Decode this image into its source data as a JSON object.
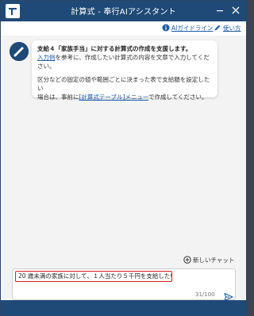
{
  "window": {
    "title": "計算式 - 奉行AIアシスタント",
    "colors": {
      "titlebar": "#1f4a78",
      "link": "#1a5aa8",
      "highlight_border": "#d62020"
    }
  },
  "toolbar": {
    "guideline_label": "AIガイドライン",
    "guideline_icon": "info-icon",
    "howto_label": "使い方",
    "howto_icon": "pen-icon"
  },
  "assistant_message": {
    "title": "支給４「家族手当」に対する計算式の作成を支援します。",
    "line1_link": "入力例",
    "line1_rest": "を参考に、作成したい計算式の内容を文章で入力してください。",
    "line2": "区分などの固定の値や範囲ごとに決まった表で支給額を設定したい",
    "line3_prefix": "場合は、事前に",
    "line3_link": "[計算式テーブル]メニュー",
    "line3_suffix": "で作成してください。"
  },
  "chat": {
    "new_chat_label": "新しいチャット",
    "new_chat_icon": "plus-circle-icon",
    "input_value": "20 歳未満の家族に対して、１人当たり５千円を支給したい",
    "char_count": "31/100",
    "send_icon": "send-icon"
  }
}
